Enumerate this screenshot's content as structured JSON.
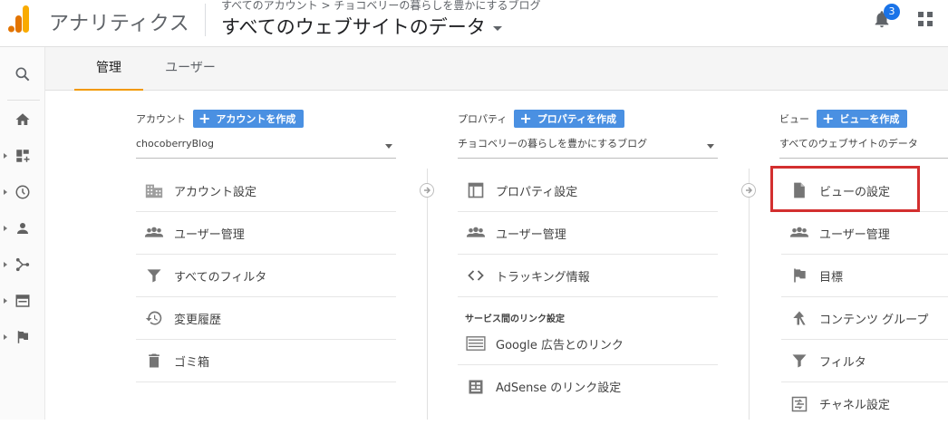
{
  "app": {
    "title": "アナリティクス",
    "breadcrumb": "すべてのアカウント > チョコベリーの暮らしを豊かにするブログ",
    "view_name": "すべてのウェブサイトのデータ",
    "notification_count": "3",
    "brand_color": "#f9ab00"
  },
  "tabs": [
    {
      "label": "管理",
      "active": true
    },
    {
      "label": "ユーザー",
      "active": false
    }
  ],
  "left_nav": [
    "search-icon",
    "home-icon",
    "customization-icon",
    "realtime-icon",
    "audience-icon",
    "acquisition-icon",
    "behavior-icon",
    "conversions-icon"
  ],
  "account": {
    "label": "アカウント",
    "create_button": "アカウントを作成",
    "selected": "chocoberryBlog",
    "items": [
      {
        "label": "アカウント設定",
        "icon": "building-icon"
      },
      {
        "label": "ユーザー管理",
        "icon": "people-icon"
      },
      {
        "label": "すべてのフィルタ",
        "icon": "filter-icon"
      },
      {
        "label": "変更履歴",
        "icon": "history-icon"
      },
      {
        "label": "ゴミ箱",
        "icon": "trash-icon"
      }
    ]
  },
  "property": {
    "label": "プロパティ",
    "create_button": "プロパティを作成",
    "selected": "チョコベリーの暮らしを豊かにするブログ",
    "items": [
      {
        "label": "プロパティ設定",
        "icon": "window-icon"
      },
      {
        "label": "ユーザー管理",
        "icon": "people-icon"
      },
      {
        "label": "トラッキング情報",
        "icon": "code-icon"
      }
    ],
    "section_label": "サービス間のリンク設定",
    "link_items": [
      {
        "label": "Google 広告とのリンク",
        "icon": "ads-icon"
      },
      {
        "label": "AdSense のリンク設定",
        "icon": "adsense-icon"
      }
    ]
  },
  "view": {
    "label": "ビュー",
    "create_button": "ビューを作成",
    "selected": "すべてのウェブサイトのデータ",
    "items": [
      {
        "label": "ビューの設定",
        "icon": "document-icon"
      },
      {
        "label": "ユーザー管理",
        "icon": "people-icon"
      },
      {
        "label": "目標",
        "icon": "flag-icon"
      },
      {
        "label": "コンテンツ グループ",
        "icon": "content-group-icon"
      },
      {
        "label": "フィルタ",
        "icon": "filter-icon"
      },
      {
        "label": "チャネル設定",
        "icon": "channel-icon"
      }
    ]
  },
  "colors": {
    "accent_blue": "#4a90e2",
    "tab_underline": "#f29900",
    "highlight_red": "#d32f2f"
  }
}
